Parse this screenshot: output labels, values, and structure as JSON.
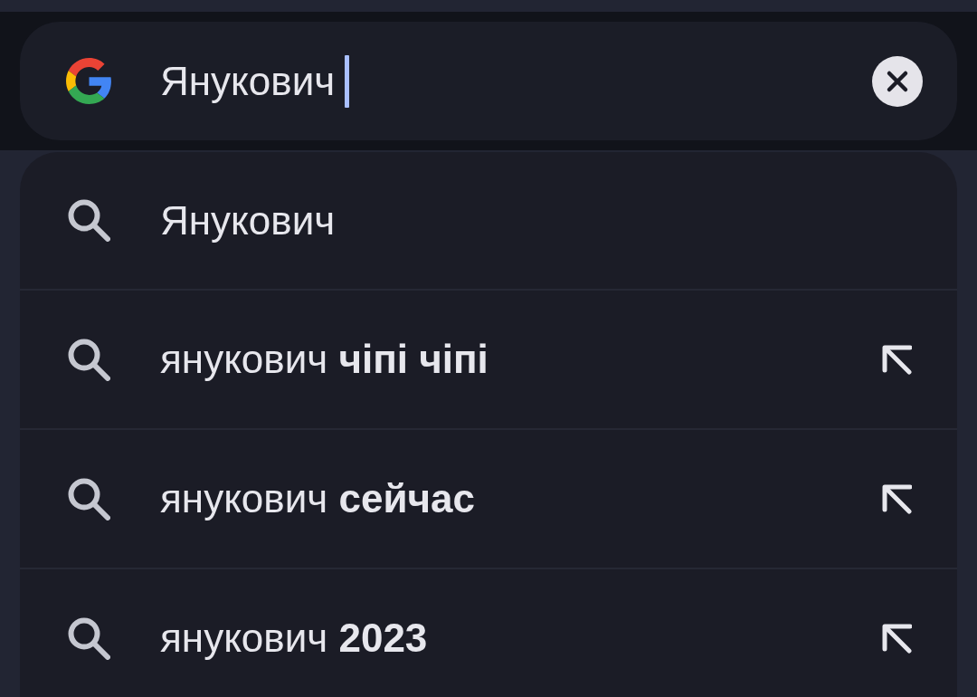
{
  "search_bar": {
    "value": "Янукович",
    "focused": true
  },
  "suggestions": [
    {
      "text": "Янукович",
      "kind": "typed"
    },
    {
      "text": "янукович **чіпі чіпі**",
      "kind": "completion"
    },
    {
      "text": "янукович **сейчас**",
      "kind": "completion"
    },
    {
      "text": "янукович **2023**",
      "kind": "completion"
    }
  ]
}
